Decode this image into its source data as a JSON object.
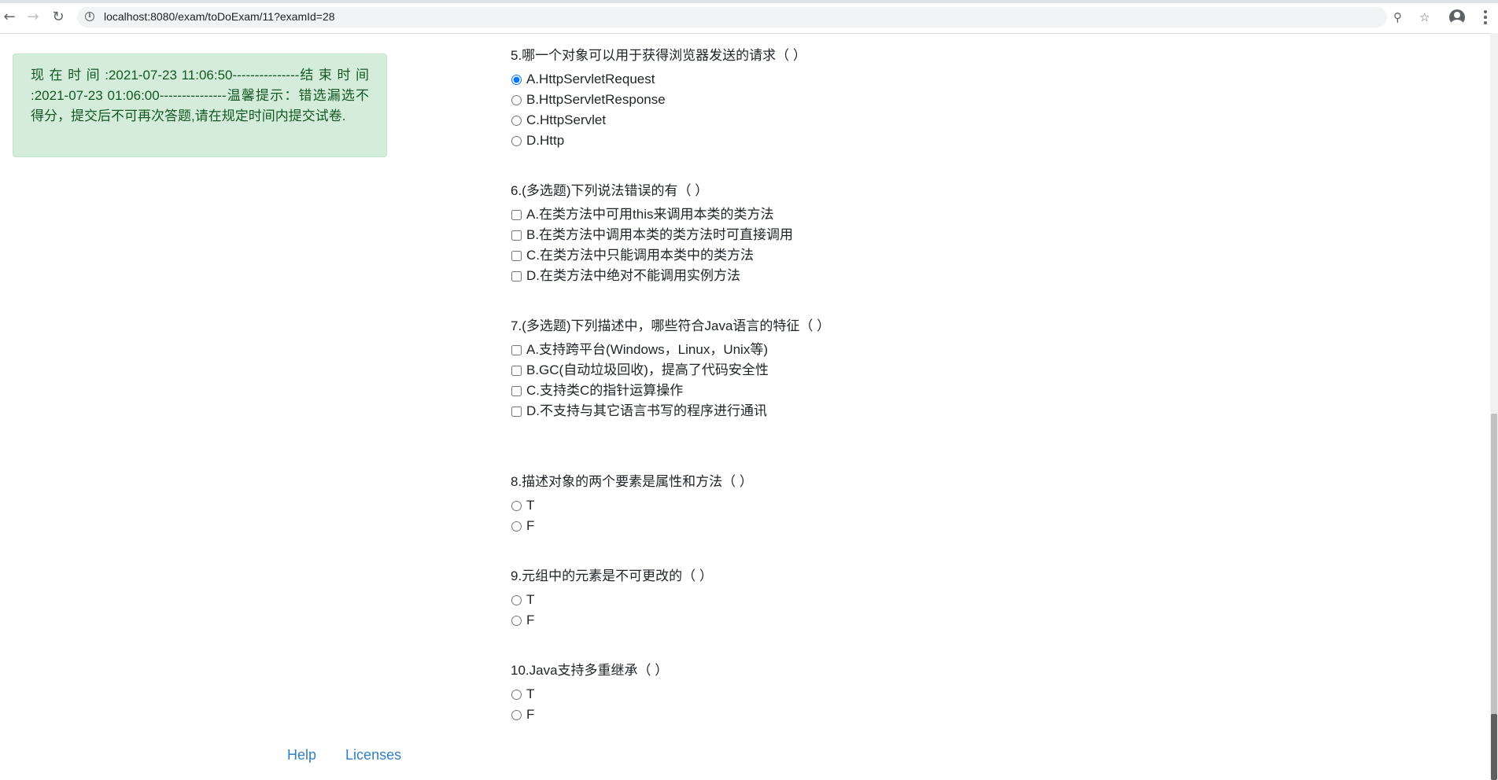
{
  "browser": {
    "url": "localhost:8080/exam/toDoExam/11?examId=28",
    "back_icon": "arrow-left-icon",
    "forward_icon": "arrow-right-icon",
    "reload_icon": "reload-icon"
  },
  "alert": {
    "text": "现 在 时 间 :2021-07-23 11:06:50---------------结 束 时 间 :2021-07-23 01:06:00---------------温馨提示：错选漏选不得分，提交后不可再次答题,请在规定时间内提交试卷."
  },
  "questions": [
    {
      "title": "5.哪一个对象可以用于获得浏览器发送的请求（ ）",
      "type": "radio",
      "options": [
        "A.HttpServletRequest",
        "B.HttpServletResponse",
        "C.HttpServlet",
        "D.Http"
      ],
      "checked": [
        0
      ]
    },
    {
      "title": "6.(多选题)下列说法错误的有（ ）",
      "type": "checkbox",
      "options": [
        "A.在类方法中可用this来调用本类的类方法",
        "B.在类方法中调用本类的类方法时可直接调用",
        "C.在类方法中只能调用本类中的类方法",
        "D.在类方法中绝对不能调用实例方法"
      ],
      "checked": []
    },
    {
      "title": "7.(多选题)下列描述中，哪些符合Java语言的特征（ ）",
      "type": "checkbox",
      "options": [
        "A.支持跨平台(Windows，Linux，Unix等)",
        "B.GC(自动垃圾回收)，提高了代码安全性",
        "C.支持类C的指针运算操作",
        "D.不支持与其它语言书写的程序进行通讯"
      ],
      "checked": []
    },
    {
      "title": "8.描述对象的两个要素是属性和方法（ ）",
      "type": "radio",
      "options": [
        "T",
        "F"
      ],
      "checked": []
    },
    {
      "title": "9.元组中的元素是不可更改的（ ）",
      "type": "radio",
      "options": [
        "T",
        "F"
      ],
      "checked": []
    },
    {
      "title": "10.Java支持多重继承（ ）",
      "type": "radio",
      "options": [
        "T",
        "F"
      ],
      "checked": []
    }
  ],
  "footer": {
    "help": "Help",
    "licenses": "Licenses"
  }
}
